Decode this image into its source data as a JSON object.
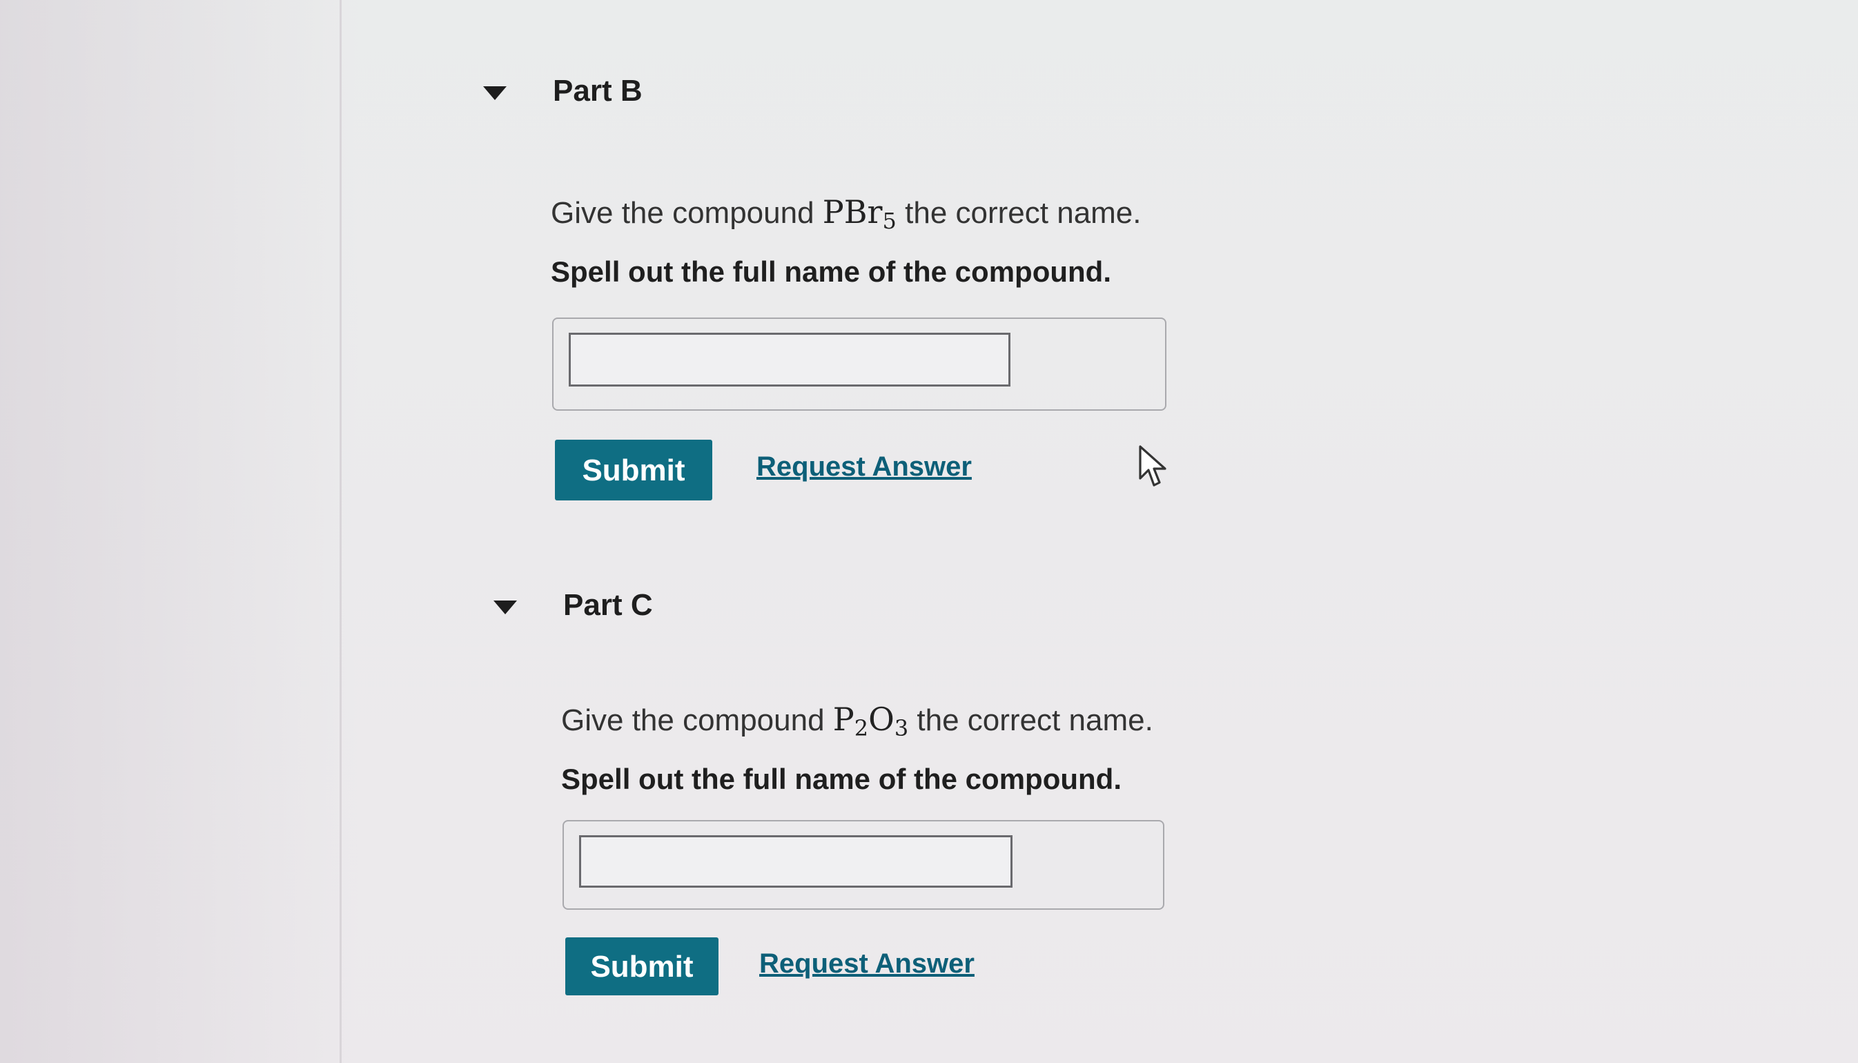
{
  "parts": [
    {
      "title": "Part B",
      "prompt_before": "Give the compound ",
      "formula_main": "PBr",
      "formula_sub": "5",
      "formula_main2": "",
      "formula_sub2": "",
      "prompt_after": " the correct name.",
      "instruction": "Spell out the full name of the compound.",
      "answer_value": "",
      "submit_label": "Submit",
      "request_label": "Request Answer"
    },
    {
      "title": "Part C",
      "prompt_before": "Give the compound ",
      "formula_main": "P",
      "formula_sub": "2",
      "formula_main2": "O",
      "formula_sub2": "3",
      "prompt_after": " the correct name.",
      "instruction": "Spell out the full name of the compound.",
      "answer_value": "",
      "submit_label": "Submit",
      "request_label": "Request Answer"
    }
  ],
  "colors": {
    "submit_bg": "#0f6e83",
    "link": "#0d5f78"
  },
  "icons": {
    "toggle": "caret-down-icon",
    "pointer": "mouse-pointer-icon"
  }
}
